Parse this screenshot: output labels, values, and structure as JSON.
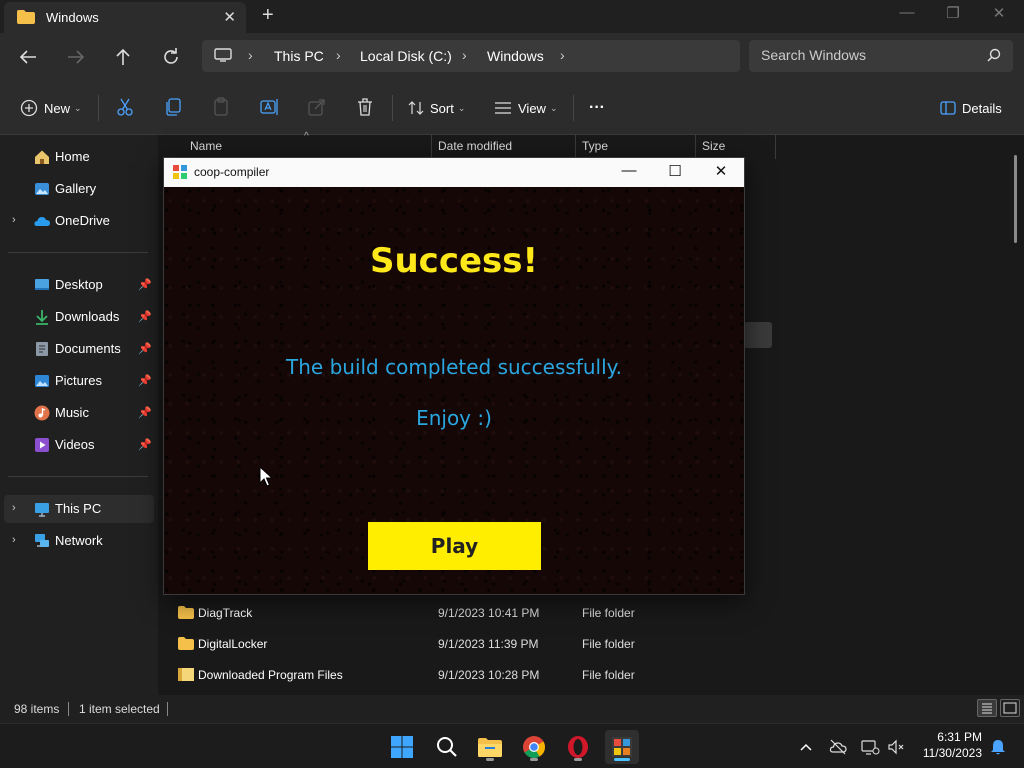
{
  "window": {
    "tab_label": "Windows",
    "tab_close": "✕",
    "new_tab": "+",
    "minimize": "—",
    "maximize": "❐",
    "close": "✕"
  },
  "address": {
    "crumbs": [
      "This PC",
      "Local Disk (C:)",
      "Windows"
    ],
    "separator": "›",
    "search_placeholder": "Search Windows"
  },
  "commands": {
    "new": "New",
    "sort": "Sort",
    "view": "View",
    "more": "···",
    "details": "Details",
    "caret": "⌄"
  },
  "sidebar": {
    "items": [
      {
        "label": "Home",
        "icon": "home-icon",
        "color": "#e9c46a"
      },
      {
        "label": "Gallery",
        "icon": "gallery-icon",
        "color": "#3a8fd9"
      },
      {
        "label": "OneDrive",
        "icon": "onedrive-icon",
        "color": "#2a9cf0"
      },
      {
        "label": "Desktop",
        "icon": "desktop-icon",
        "color": "#4aa3e0"
      },
      {
        "label": "Downloads",
        "icon": "downloads-icon",
        "color": "#3ab56a"
      },
      {
        "label": "Documents",
        "icon": "documents-icon",
        "color": "#8d98a7"
      },
      {
        "label": "Pictures",
        "icon": "pictures-icon",
        "color": "#2f86d6"
      },
      {
        "label": "Music",
        "icon": "music-icon",
        "color": "#e0734a"
      },
      {
        "label": "Videos",
        "icon": "videos-icon",
        "color": "#8b4fd0"
      },
      {
        "label": "This PC",
        "icon": "pc-icon",
        "color": "#3aa0e6"
      },
      {
        "label": "Network",
        "icon": "network-icon",
        "color": "#3aa0e6"
      }
    ],
    "chevron": "›",
    "pin": "📌"
  },
  "columns": {
    "name": "Name",
    "date": "Date modified",
    "type": "Type",
    "size": "Size",
    "sort_arrow": "^"
  },
  "files": [
    {
      "name": "DiagTrack",
      "date": "9/1/2023 10:41 PM",
      "type": "File folder"
    },
    {
      "name": "DigitalLocker",
      "date": "9/1/2023 11:39 PM",
      "type": "File folder"
    },
    {
      "name": "Downloaded Program Files",
      "date": "9/1/2023 10:28 PM",
      "type": "File folder"
    }
  ],
  "status": {
    "items": "98 items",
    "selected": "1 item selected"
  },
  "dialog": {
    "title": "coop-compiler",
    "heading": "Success!",
    "message": "The build completed successfully.",
    "enjoy": "Enjoy :)",
    "play": "Play",
    "minimize": "—",
    "maximize": "☐",
    "close": "✕"
  },
  "clock": {
    "time": "6:31 PM",
    "date": "11/30/2023"
  },
  "colors": {
    "accent": "#ffee00",
    "text_blue": "#2aa6e0",
    "heading_yellow": "#ffe81a"
  }
}
